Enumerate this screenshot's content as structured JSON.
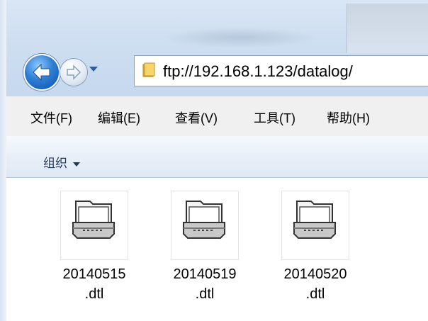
{
  "navigation": {
    "back_icon": "back-arrow-icon",
    "forward_icon": "forward-arrow-icon",
    "history_dropdown_icon": "chevron-down-icon"
  },
  "address_bar": {
    "icon": "folder-icon",
    "value": "ftp://192.168.1.123/datalog/"
  },
  "menu": {
    "items": [
      "文件(F)",
      "编辑(E)",
      "查看(V)",
      "工具(T)",
      "帮助(H)"
    ]
  },
  "toolbar": {
    "organize_label": "组织"
  },
  "files": [
    {
      "name_line1": "20140515",
      "name_line2": ".dtl",
      "icon": "file-drawer-icon"
    },
    {
      "name_line1": "20140519",
      "name_line2": ".dtl",
      "icon": "file-drawer-icon"
    },
    {
      "name_line1": "20140520",
      "name_line2": ".dtl",
      "icon": "file-drawer-icon"
    }
  ]
}
